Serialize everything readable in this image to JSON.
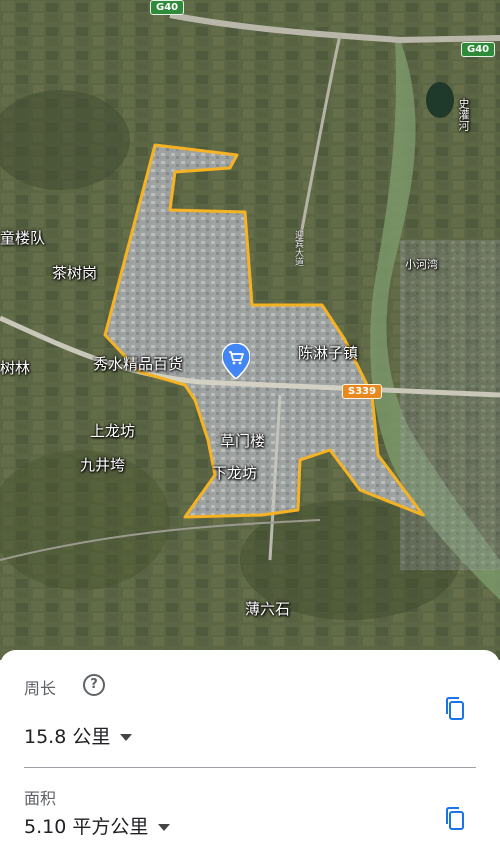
{
  "map": {
    "places": [
      {
        "id": "tonglou",
        "text": "童楼队"
      },
      {
        "id": "chashugang",
        "text": "茶树岗"
      },
      {
        "id": "shulin",
        "text": "树林"
      },
      {
        "id": "xiushui",
        "text": "秀水精品百货"
      },
      {
        "id": "chenlinzi",
        "text": "陈淋子镇"
      },
      {
        "id": "shanglongfang",
        "text": "上龙坊"
      },
      {
        "id": "jiujingwan",
        "text": "九井垮"
      },
      {
        "id": "caomenlou",
        "text": "草门楼"
      },
      {
        "id": "xialongfang",
        "text": "下龙坊"
      },
      {
        "id": "boliushi",
        "text": "薄六石"
      },
      {
        "id": "xiaohewan",
        "text": "小河湾"
      },
      {
        "id": "shiguanhe",
        "text": "史灌河"
      }
    ],
    "road_labels": [
      {
        "id": "s339",
        "text": "S339"
      },
      {
        "id": "g40-top",
        "text": "G40"
      },
      {
        "id": "g40-right",
        "text": "G40"
      },
      {
        "id": "yingbin",
        "text": "迎宾大道"
      }
    ],
    "colors": {
      "boundary": "#f5b324",
      "pin": "#4285f4",
      "accent": "#1a73e8"
    },
    "pin_icon": "shopping-cart-icon"
  },
  "panel": {
    "perimeter_label": "周长",
    "perimeter_value": "15.8 公里",
    "area_label": "面积",
    "area_value": "5.10 平方公里",
    "help_symbol": "?"
  }
}
